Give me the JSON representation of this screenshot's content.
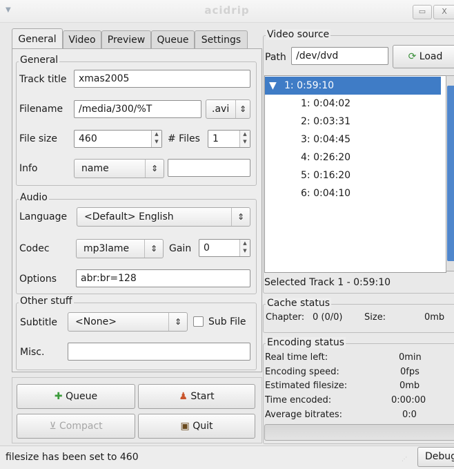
{
  "window": {
    "menu_glyph": "▼",
    "title": "acidrip",
    "min_glyph": "▭",
    "close_glyph": "X"
  },
  "tabs": [
    {
      "label": "General"
    },
    {
      "label": "Video"
    },
    {
      "label": "Preview"
    },
    {
      "label": "Queue"
    },
    {
      "label": "Settings"
    }
  ],
  "general": {
    "group_label": "General",
    "track_title_label": "Track title",
    "track_title_value": "xmas2005",
    "filename_label": "Filename",
    "filename_value": "/media/300/%T",
    "ext_value": ".avi",
    "filesize_label": "File size",
    "filesize_value": "460",
    "files_label": "# Files",
    "files_value": "1",
    "info_label": "Info",
    "info_value": "name",
    "info_text": ""
  },
  "audio": {
    "group_label": "Audio",
    "language_label": "Language",
    "language_value": "<Default> English",
    "codec_label": "Codec",
    "codec_value": "mp3lame",
    "gain_label": "Gain",
    "gain_value": "0",
    "options_label": "Options",
    "options_value": "abr:br=128"
  },
  "other": {
    "group_label": "Other stuff",
    "subtitle_label": "Subtitle",
    "subtitle_value": "<None>",
    "subfile_label": "Sub File",
    "misc_label": "Misc.",
    "misc_value": ""
  },
  "buttons": {
    "queue": "Queue",
    "start": "Start",
    "compact": "Compact",
    "quit": "Quit"
  },
  "video_source": {
    "group_label": "Video source",
    "path_label": "Path",
    "path_value": "/dev/dvd",
    "load_label": "Load",
    "tracks": [
      {
        "label": "1: 0:59:10",
        "glyph": "▼",
        "selected": true
      },
      {
        "label": "1: 0:04:02"
      },
      {
        "label": "2: 0:03:31"
      },
      {
        "label": "3: 0:04:45"
      },
      {
        "label": "4: 0:26:20"
      },
      {
        "label": "5: 0:16:20"
      },
      {
        "label": "6: 0:04:10"
      }
    ],
    "selected_text": "Selected Track 1 - 0:59:10"
  },
  "cache": {
    "group_label": "Cache status",
    "chapter_label": "Chapter:",
    "chapter_value": "0 (0/0)",
    "size_label": "Size:",
    "size_value": "0mb"
  },
  "encoding": {
    "group_label": "Encoding status",
    "rows": [
      {
        "label": "Real time left:",
        "value": "0min"
      },
      {
        "label": "Encoding speed:",
        "value": "0fps"
      },
      {
        "label": "Estimated filesize:",
        "value": "0mb"
      },
      {
        "label": "Time encoded:",
        "value": "0:00:00"
      },
      {
        "label": "Average bitrates:",
        "value": "0:0"
      }
    ],
    "progress": 0
  },
  "status": {
    "message": "filesize has been set to 460",
    "debug_label": "Debug"
  },
  "colors": {
    "selection": "#3f7cc6",
    "scroll_thumb": "#4f86cc"
  }
}
